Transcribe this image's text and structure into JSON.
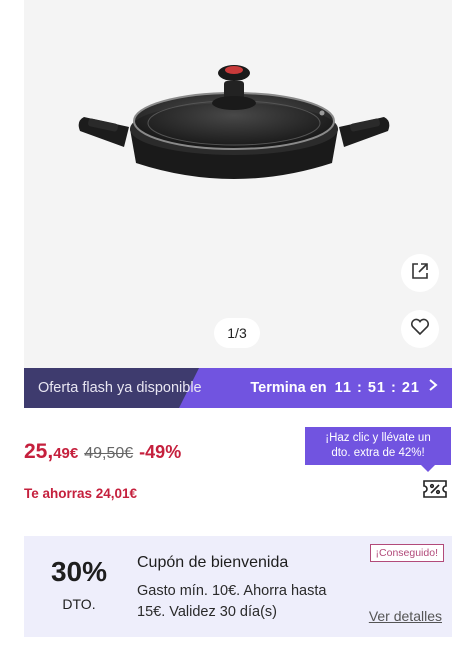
{
  "gallery": {
    "image_alt": "Cacerola antiadherente con tapa de vidrio",
    "pager": "1/3"
  },
  "flash": {
    "left_text": "Oferta flash ya disponible",
    "right_label": "Termina en",
    "time": "11 : 51 : 21"
  },
  "price": {
    "current_int": "25,",
    "current_cents": "49€",
    "original": "49,50€",
    "discount": "-49%",
    "savings": "Te ahorras 24,01€"
  },
  "promo_tip": {
    "line1": "¡Haz clic y llévate un",
    "line2": "dto. extra de 42%!"
  },
  "coupon": {
    "percent": "30%",
    "dto": "DTO.",
    "title": "Cupón de bienvenida",
    "description": "Gasto mín. 10€. Ahorra hasta 15€. Validez 30 día(s)",
    "badge": "¡Conseguido!",
    "link": "Ver detalles"
  },
  "colors": {
    "brand_purple": "#7154e0",
    "dark_navy": "#3e3b6e",
    "price_red": "#c5203d",
    "coupon_bg": "#eeeefb"
  },
  "icons": {
    "share": "share-icon",
    "favorite": "heart-icon",
    "chevron": "chevron-right-icon",
    "coupon": "coupon-icon"
  }
}
